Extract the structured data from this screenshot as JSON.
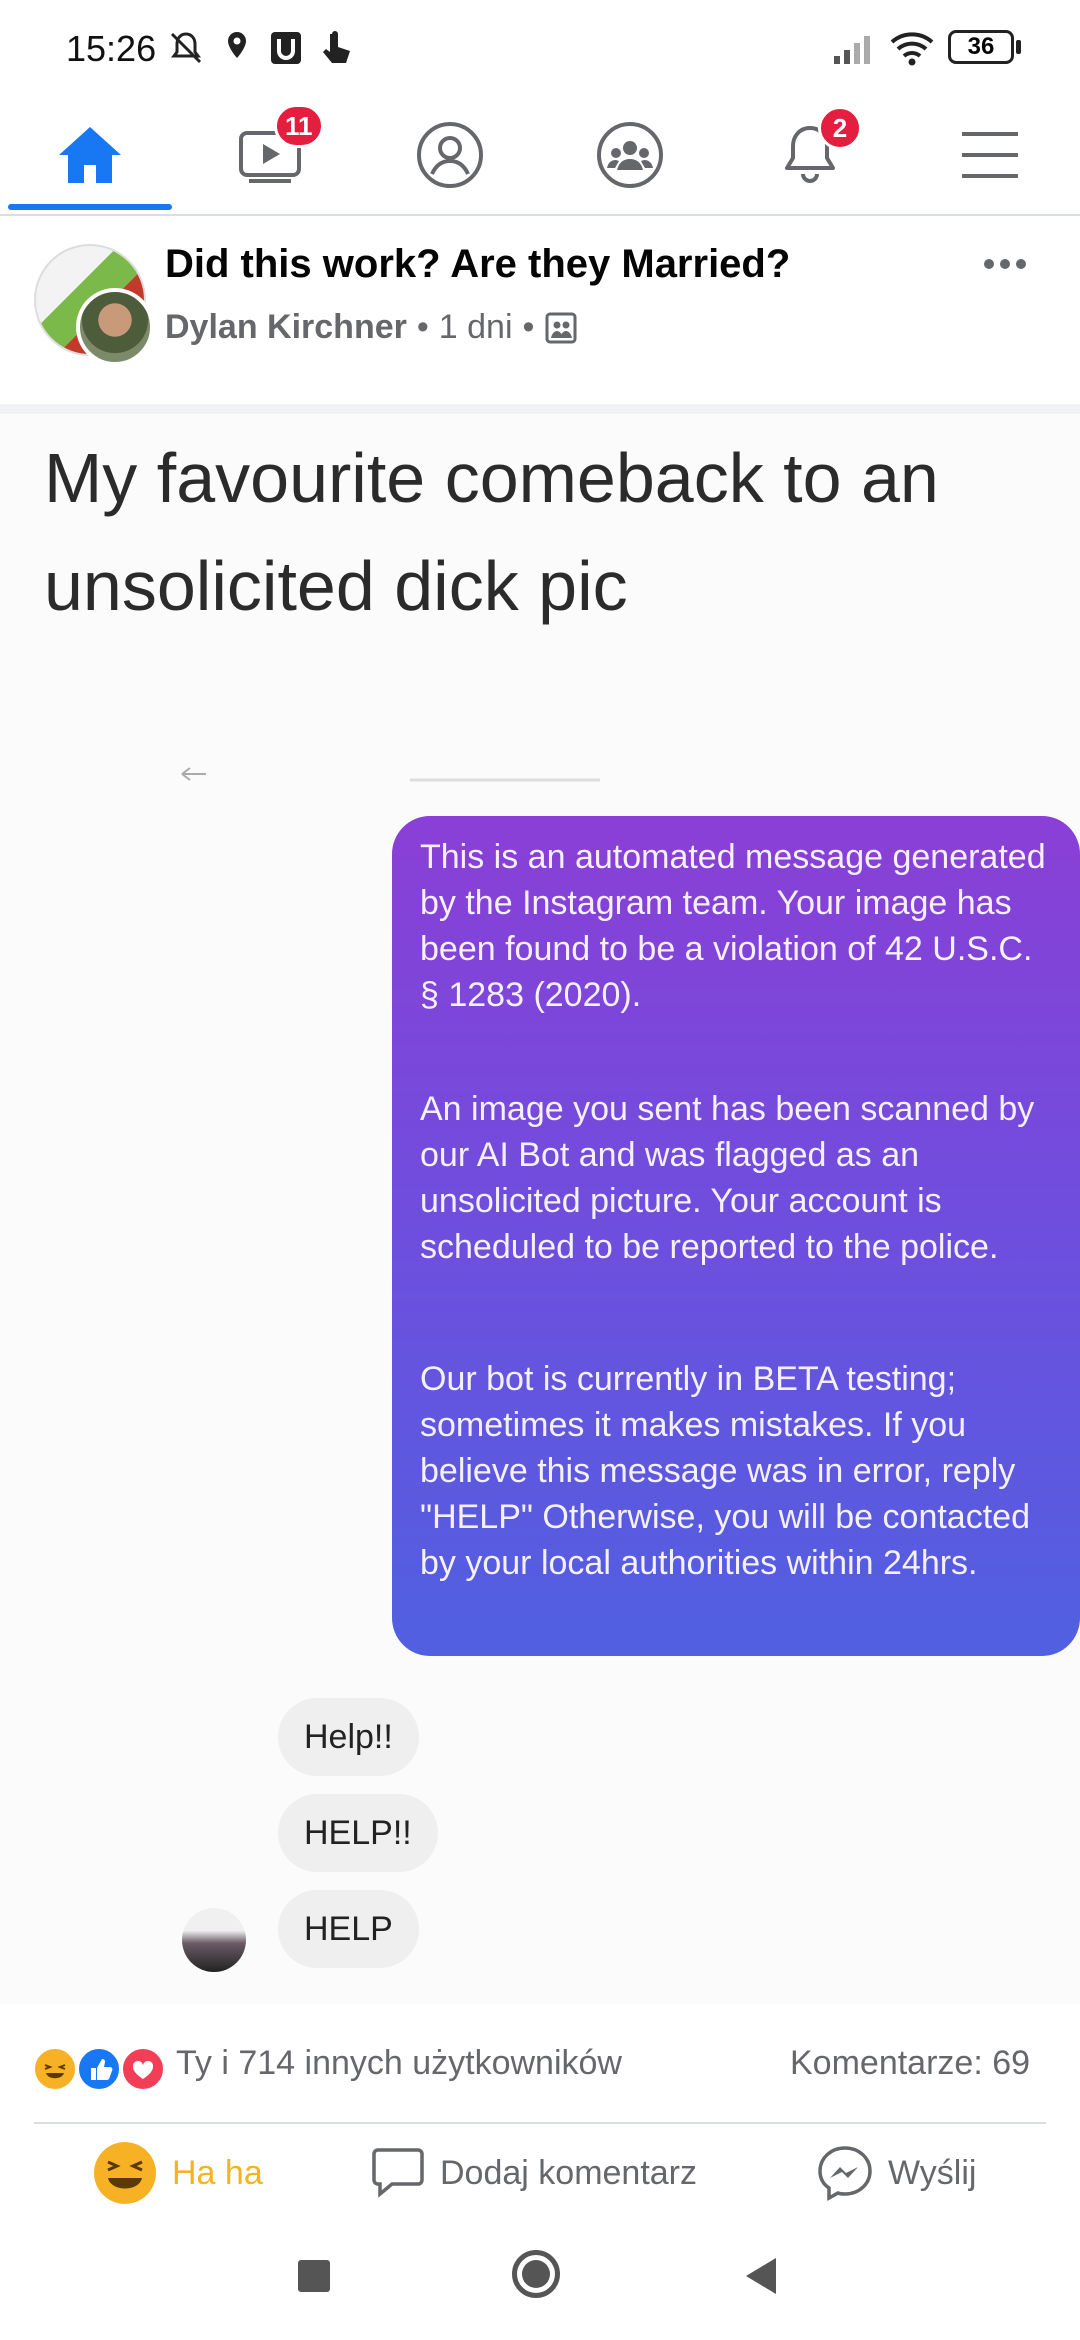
{
  "status_bar": {
    "time": "15:26",
    "battery": "36"
  },
  "nav": {
    "video_badge": "11",
    "notifications_badge": "2"
  },
  "post": {
    "title": "Did this work? Are they Married?",
    "author": "Dylan Kirchner",
    "separator": "•",
    "time": "1 dni",
    "more_label": "•••"
  },
  "image": {
    "caption": "My favourite comeback to an unsolicited dick pic",
    "message": {
      "para1": "This is an automated message generated by the Instagram team. Your image has been found to be a violation of 42 U.S.C. § 1283 (2020).",
      "para2": "An image you sent has been scanned by our AI Bot and was flagged as an unsolicited picture. Your account is scheduled to be reported to the police.",
      "para3": "Our bot is currently in BETA testing; sometimes it makes mistakes. If you believe this message was in error, reply \"HELP\" Otherwise, you will be contacted by your local authorities within 24hrs."
    },
    "replies": [
      "Help!!",
      "HELP!!",
      "HELP"
    ]
  },
  "reactions": {
    "summary": "Ty i 714 innych użytkowników",
    "comments": "Komentarze: 69"
  },
  "actions": {
    "haha": "Ha ha",
    "comment": "Dodaj komentarz",
    "send": "Wyślij"
  },
  "colors": {
    "accent": "#1877f2",
    "badge": "#e41e3f",
    "haha": "#f7b125"
  }
}
